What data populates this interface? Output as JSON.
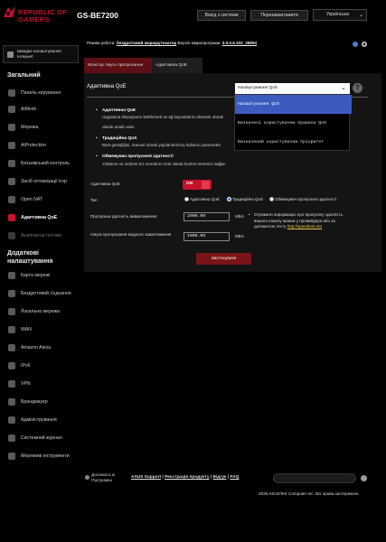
{
  "header": {
    "brand_line1": "REPUBLIC OF",
    "brand_line2": "GAMERS",
    "model": "GS-BE7200",
    "logout_label": "Вихід з системи",
    "reboot_label": "Перезавантажити",
    "language": "Українська"
  },
  "status": {
    "mode_label": "Режим роботи:",
    "mode_value": "бездротовий маршрутизатор",
    "fw_label": "Версія мікропрограми:",
    "fw_value": "3.0.0.6.102_38993"
  },
  "sidebar": {
    "quick_setup": "Швидке налаштування Інтернет",
    "general_title": "Загальний",
    "general_items": [
      {
        "label": "Панель керування",
        "icon": "dashboard-icon"
      },
      {
        "label": "AiMesh",
        "icon": "mesh-icon"
      },
      {
        "label": "Мережа",
        "icon": "network-icon"
      },
      {
        "label": "AiProtection",
        "icon": "shield-icon"
      },
      {
        "label": "Батьківський контроль",
        "icon": "parental-icon"
      },
      {
        "label": "Засіб оптимізації ігор",
        "icon": "game-icon"
      },
      {
        "label": "Open NAT",
        "icon": "nat-icon"
      },
      {
        "label": "Адаптивна QoE",
        "icon": "qos-icon"
      },
      {
        "label": "Аналізатор потоків",
        "icon": "traffic-icon"
      }
    ],
    "advanced_title": "Додаткові налаштування",
    "advanced_items": [
      {
        "label": "Карта мережі",
        "icon": "map-icon"
      },
      {
        "label": "Бездротовий з'єднання",
        "icon": "wifi-icon"
      },
      {
        "label": "Локальна мережа",
        "icon": "lan-icon"
      },
      {
        "label": "WAN",
        "icon": "globe-icon"
      },
      {
        "label": "Amazon Alexa",
        "icon": "alexa-icon"
      },
      {
        "label": "IPv6",
        "icon": "ipv6-icon"
      },
      {
        "label": "VPN",
        "icon": "vpn-icon"
      },
      {
        "label": "Брандмауер",
        "icon": "firewall-icon"
      },
      {
        "label": "Адміністрування",
        "icon": "admin-icon"
      },
      {
        "label": "Системний журнал",
        "icon": "log-icon"
      },
      {
        "label": "Мережеві інструменти",
        "icon": "tools-icon"
      }
    ]
  },
  "tabs": [
    {
      "label": "Монітор смуги пропускання"
    },
    {
      "label": "Адаптивна QoE"
    }
  ],
  "panel": {
    "title": "Адаптивна QoE",
    "dropdown": {
      "selected": "Налаштування QoS",
      "options": [
        "Налаштування QoS",
        "Визначені користувачем правила QoS",
        "Визначений користувачем пріоритет"
      ]
    },
    "descriptions": [
      {
        "title": "Адаптивна QoE",
        "lines": [
          "Uygulama ihtiyaçlarını belirlemek ve ağ kaynaklarını dinamik olarak",
          "olarak analiz eder."
        ]
      },
      {
        "title": "Традиційна QoS",
        "lines": [
          "Bant genişliğini, manuel olarak yapılandırılmış kullanıcı parametre"
        ]
      },
      {
        "title": "Обмежувач пропускної здатності",
        "lines": [
          "Yükleme ve indirme hız sınırlarını özel olarak kontrol etmenizi sağlar."
        ]
      }
    ],
    "enable_label": "Адаптивна QoE",
    "toggle_value": "ON",
    "type_label": "Тип",
    "type_options": [
      "Адаптивна QoE",
      "Традиційна QoS",
      "Обмежувач пропускної здатності"
    ],
    "type_selected": 1,
    "upload_label": "Пропускна здатність вивантаження",
    "upload_value": "2000.00",
    "download_label": "Смуга пропускання вхідного завантаження",
    "download_value": "1000.00",
    "unit": "Mb/s",
    "note": "Отримати інформацію про пропускну здатність вашого каналу можна у провайдера або за допомогою тесту",
    "note_link": "http://speedtest.net",
    "apply_label": "Застосувати"
  },
  "footer": {
    "help": "Допомога & Підтримка",
    "links": [
      "ASUS Support",
      "Реєстрація продукту",
      "Відгук",
      "FAQ"
    ],
    "copyright": "2026 ASUSTeK Computer Inc. Всі права застережені."
  }
}
